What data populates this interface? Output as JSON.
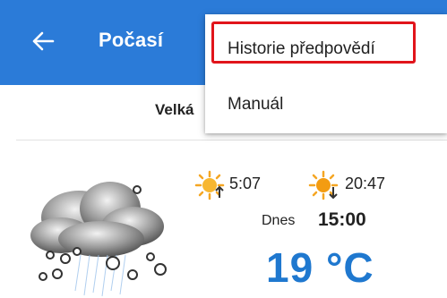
{
  "appbar": {
    "title": "Počasí",
    "color": "#2b7bd8"
  },
  "subheader": {
    "title": "Velká"
  },
  "menu": {
    "items": [
      {
        "label": "Historie předpovědí",
        "highlighted": true
      },
      {
        "label": "Manuál"
      }
    ],
    "highlight_color": "#e1141b"
  },
  "weather": {
    "icon": "cloud-rain-icon",
    "sunrise": "5:07",
    "sunset": "20:47",
    "day_label": "Dnes",
    "time": "15:00",
    "temperature": "19 °C",
    "temperature_color": "#1f78cf"
  }
}
